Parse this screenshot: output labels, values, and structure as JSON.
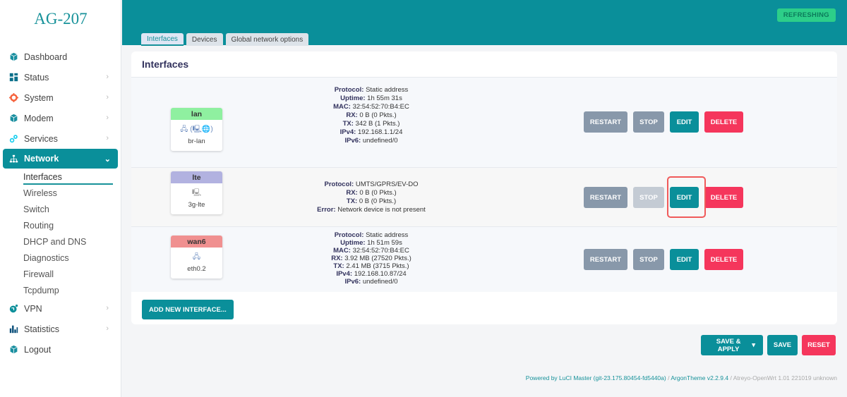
{
  "brand": "AG-207",
  "sidebar": {
    "items": [
      {
        "label": "Dashboard",
        "icon": "cube-icon",
        "chevron": false
      },
      {
        "label": "Status",
        "icon": "grid-icon",
        "chevron": true
      },
      {
        "label": "System",
        "icon": "gear-icon",
        "chevron": true
      },
      {
        "label": "Modem",
        "icon": "cube-icon",
        "chevron": true
      },
      {
        "label": "Services",
        "icon": "cogs-icon",
        "chevron": true
      },
      {
        "label": "Network",
        "icon": "sitemap-icon",
        "chevron": true,
        "active": true
      },
      {
        "label": "VPN",
        "icon": "globe-icon",
        "chevron": true
      },
      {
        "label": "Statistics",
        "icon": "bar-chart-icon",
        "chevron": true
      },
      {
        "label": "Logout",
        "icon": "cube-icon",
        "chevron": false
      }
    ],
    "network_sub": [
      "Interfaces",
      "Wireless",
      "Switch",
      "Routing",
      "DHCP and DNS",
      "Diagnostics",
      "Firewall",
      "Tcpdump"
    ]
  },
  "header": {
    "refresh_label": "REFRESHING",
    "tabs": [
      "Interfaces",
      "Devices",
      "Global network options"
    ]
  },
  "card": {
    "title": "Interfaces",
    "interfaces": [
      {
        "name": "lan",
        "color": "#8ff0a0",
        "device": "br-lan",
        "icons": "🖧 (🖳🌐)",
        "info": [
          [
            "Protocol:",
            "Static address"
          ],
          [
            "Uptime:",
            "1h 55m 31s"
          ],
          [
            "MAC:",
            "32:54:52:70:B4:EC"
          ],
          [
            "RX:",
            "0 B (0 Pkts.)"
          ],
          [
            "TX:",
            "342 B (1 Pkts.)"
          ],
          [
            "IPv4:",
            "192.168.1.1/24"
          ],
          [
            "IPv6:",
            "undefined/0"
          ]
        ],
        "stop_disabled": false
      },
      {
        "name": "lte",
        "color": "#b2b2e0",
        "device": "3g-lte",
        "icons": "🖳",
        "info": [
          [
            "Protocol:",
            "UMTS/GPRS/EV-DO"
          ],
          [
            "RX:",
            "0 B (0 Pkts.)"
          ],
          [
            "TX:",
            "0 B (0 Pkts.)"
          ],
          [
            "Error:",
            "Network device is not present"
          ]
        ],
        "stop_disabled": true
      },
      {
        "name": "wan6",
        "color": "#f09090",
        "device": "eth0.2",
        "icons": "🖧",
        "info": [
          [
            "Protocol:",
            "Static address"
          ],
          [
            "Uptime:",
            "1h 51m 59s"
          ],
          [
            "MAC:",
            "32:54:52:70:B4:EC"
          ],
          [
            "RX:",
            "3.92 MB (27520 Pkts.)"
          ],
          [
            "TX:",
            "2.41 MB (3715 Pkts.)"
          ],
          [
            "IPv4:",
            "192.168.10.87/24"
          ],
          [
            "IPv6:",
            "undefined/0"
          ]
        ],
        "stop_disabled": false
      }
    ],
    "buttons": {
      "restart": "RESTART",
      "stop": "STOP",
      "edit": "EDIT",
      "delete": "DELETE"
    },
    "add_label": "ADD NEW INTERFACE..."
  },
  "actions": {
    "save_apply": "SAVE & APPLY",
    "save": "SAVE",
    "reset": "RESET"
  },
  "footer": {
    "luci": "Powered by LuCI Master (git-23.175.80454-fd5440a)",
    "sep1": " / ",
    "theme": "ArgonTheme v2.2.9.4",
    "sep2": " / ",
    "build": "Atreyo-OpenWrt 1.01 221019 unknown"
  }
}
